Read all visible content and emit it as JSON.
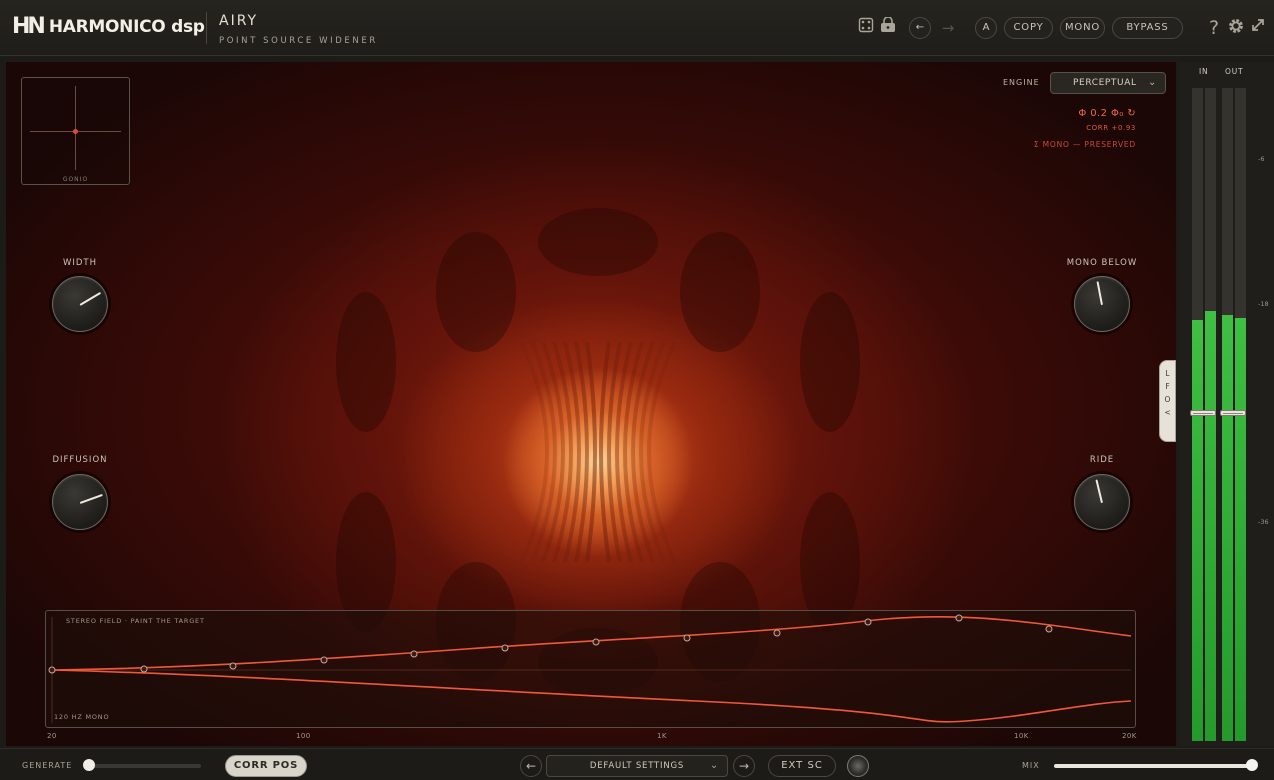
{
  "header": {
    "logo_mark": "HN",
    "brand": "HARMONICO dsp",
    "plugin_name": "AIRY",
    "plugin_subtitle": "POINT SOURCE WIDENER",
    "ab_label": "A",
    "copy_label": "COPY",
    "mono_label": "MONO",
    "bypass_label": "BYPASS",
    "help_label": "?"
  },
  "display": {
    "gonio_label": "GONIO",
    "engine_label": "ENGINE",
    "engine_value": "PERCEPTUAL",
    "phase_readout": "Φ 0.2 Φ₀ ↻",
    "corr_readout": "CORR +0.93",
    "mono_status": "Σ MONO — PRESERVED",
    "lfo_tab": [
      "L",
      "F",
      "O",
      "<"
    ]
  },
  "knobs": {
    "width": {
      "label": "WIDTH",
      "value": 0.72
    },
    "diffusion": {
      "label": "DIFFUSION",
      "value": 0.76
    },
    "mono_below": {
      "label": "MONO BELOW",
      "value": 0.46
    },
    "ride": {
      "label": "RIDE",
      "value": 0.45
    }
  },
  "stereo_field": {
    "title": "STEREO FIELD · PAINT THE TARGET",
    "footer": "120 HZ MONO",
    "freq_labels": [
      "20",
      "100",
      "1K",
      "10K",
      "20K"
    ]
  },
  "meters": {
    "in_label": "IN",
    "out_label": "OUT",
    "scale": [
      "-6",
      "-18",
      "-36"
    ],
    "in_levels": [
      0.645,
      0.659
    ],
    "out_levels": [
      0.653,
      0.648
    ],
    "fader_position": 0.5
  },
  "footer": {
    "generate_label": "GENERATE",
    "generate_value": 0.0,
    "corr_pos_label": "CORR POS",
    "prev_label": "←",
    "next_label": "→",
    "preset_name": "DEFAULT SETTINGS",
    "ext_sc_label": "EXT SC",
    "mix_label": "MIX",
    "mix_value": 1.0
  },
  "colors": {
    "accent": "#f2684a",
    "meter_green": "#3fbf43",
    "curve": "#f0583a"
  }
}
